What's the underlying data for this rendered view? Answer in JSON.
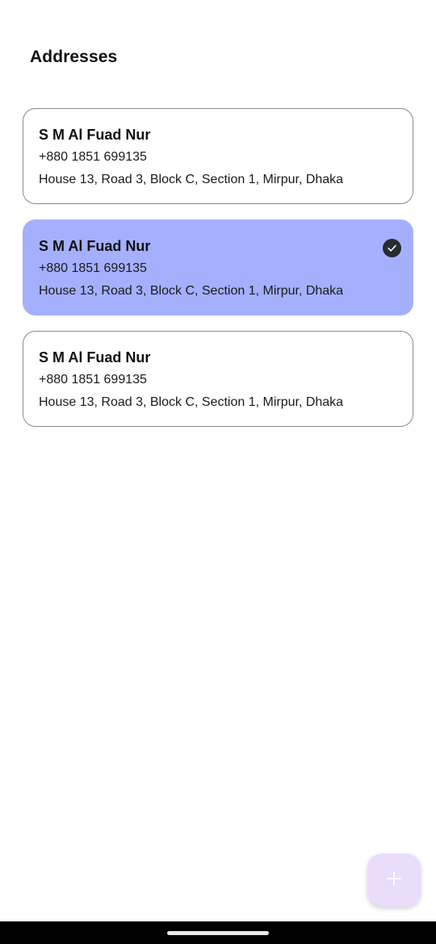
{
  "header": {
    "title": "Addresses"
  },
  "addresses": [
    {
      "name": "S M Al Fuad Nur",
      "phone": "+880 1851 699135",
      "address": "House 13, Road 3, Block C, Section 1, Mirpur, Dhaka",
      "selected": false
    },
    {
      "name": "S M Al Fuad Nur",
      "phone": "+880 1851 699135",
      "address": "House 13, Road 3, Block C, Section 1, Mirpur, Dhaka",
      "selected": true
    },
    {
      "name": "S M Al Fuad Nur",
      "phone": "+880 1851 699135",
      "address": "House 13, Road 3, Block C, Section 1, Mirpur, Dhaka",
      "selected": false
    }
  ],
  "icons": {
    "selected_indicator": "check-circle-icon",
    "fab": "plus-icon"
  },
  "colors": {
    "selected_card": "#a4b0fd",
    "card_border": "#8a8a8a",
    "fab_background": "#eadcfb",
    "fab_icon": "#ffffff",
    "check_background": "#2a2a30"
  }
}
